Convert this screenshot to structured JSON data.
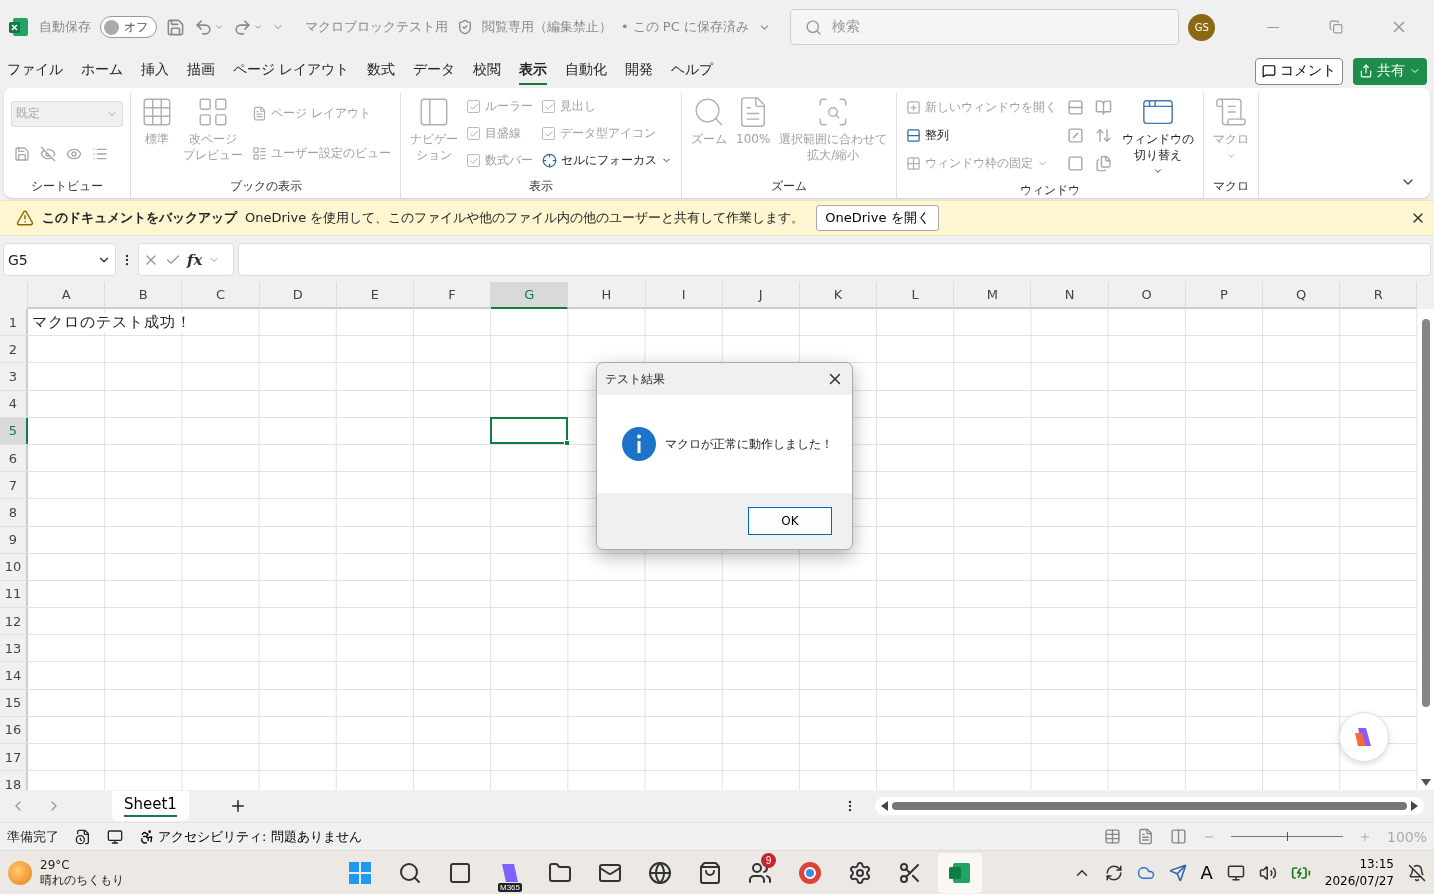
{
  "title_bar": {
    "autosave_label": "自動保存",
    "autosave": {
      "on": false,
      "label": "オフ"
    },
    "file_name": "マクロブロックテスト用",
    "mode": "閲覧専用（編集禁止）",
    "save_state": "• この PC に保存済み",
    "search_placeholder": "検索",
    "avatar": "GS"
  },
  "menu": {
    "tabs": [
      {
        "label": "ファイル",
        "selected": false
      },
      {
        "label": "ホーム",
        "selected": false
      },
      {
        "label": "挿入",
        "selected": false
      },
      {
        "label": "描画",
        "selected": false
      },
      {
        "label": "ページ レイアウト",
        "selected": false
      },
      {
        "label": "数式",
        "selected": false
      },
      {
        "label": "データ",
        "selected": false
      },
      {
        "label": "校閲",
        "selected": false
      },
      {
        "label": "表示",
        "selected": true
      },
      {
        "label": "自動化",
        "selected": false
      },
      {
        "label": "開発",
        "selected": false
      },
      {
        "label": "ヘルプ",
        "selected": false
      }
    ],
    "comment_button": "コメント",
    "share_button": "共有"
  },
  "ribbon": [
    {
      "label": "シートビュー",
      "columns": [
        [
          {
            "kind": "dropdown",
            "value": "既定",
            "disabled": true
          },
          {
            "kind": "icons",
            "disabled": true
          }
        ]
      ]
    },
    {
      "label": "ブックの表示",
      "columns": [
        [
          {
            "kind": "large",
            "label": "標準",
            "disabled": true
          }
        ],
        [
          {
            "kind": "large",
            "label": [
              "改ページ",
              "プレビュー"
            ],
            "disabled": true
          }
        ],
        [
          {
            "kind": "small",
            "label": "ページ レイアウト",
            "disabled": true
          },
          {
            "kind": "small",
            "label": "ユーザー設定のビュー",
            "disabled": true
          }
        ]
      ]
    },
    {
      "label": "表示",
      "columns": [
        [
          {
            "kind": "large",
            "label": [
              "ナビゲー",
              "ション"
            ],
            "disabled": true
          }
        ],
        [
          {
            "kind": "check",
            "label": "ルーラー",
            "checked": true,
            "disabled": true
          },
          {
            "kind": "check",
            "label": "目盛線",
            "checked": true,
            "disabled": true
          },
          {
            "kind": "check",
            "label": "数式バー",
            "checked": true,
            "disabled": true
          }
        ],
        [
          {
            "kind": "check",
            "label": "見出し",
            "checked": true,
            "disabled": true
          },
          {
            "kind": "check",
            "label": "データ型アイコン",
            "checked": true,
            "disabled": true
          },
          {
            "kind": "small",
            "label": "セルにフォーカス",
            "disabled": false,
            "menu": true
          }
        ]
      ]
    },
    {
      "label": "ズーム",
      "columns": [
        [
          {
            "kind": "large",
            "label": "ズーム",
            "disabled": true
          }
        ],
        [
          {
            "kind": "large",
            "label": "100%",
            "disabled": true
          }
        ],
        [
          {
            "kind": "large",
            "label": [
              "選択範囲に合わせて",
              "拡大/縮小"
            ],
            "disabled": true
          }
        ]
      ]
    },
    {
      "label": "ウィンドウ",
      "columns": [
        [
          {
            "kind": "small",
            "label": "新しいウィンドウを開く",
            "disabled": true
          },
          {
            "kind": "small",
            "label": "整列",
            "disabled": false
          },
          {
            "kind": "small",
            "label": "ウィンドウ枠の固定",
            "disabled": true,
            "menu": true
          }
        ],
        [
          {
            "kind": "icon",
            "disabled": true
          },
          {
            "kind": "icon",
            "disabled": true
          },
          {
            "kind": "icon",
            "disabled": true
          }
        ],
        [
          {
            "kind": "icon",
            "disabled": true
          },
          {
            "kind": "icon",
            "disabled": true
          },
          {
            "kind": "icon",
            "disabled": true
          }
        ],
        [
          {
            "kind": "large",
            "label": [
              "ウィンドウの",
              "切り替え"
            ],
            "disabled": false,
            "menu": true
          }
        ]
      ]
    },
    {
      "label": "マクロ",
      "columns": [
        [
          {
            "kind": "large",
            "label": "マクロ",
            "disabled": true,
            "menu": true
          }
        ]
      ]
    }
  ],
  "info_bar": {
    "title": "このドキュメントをバックアップ",
    "message": "OneDrive を使用して、このファイルや他のファイル内の他のユーザーと共有して作業します。",
    "button": "OneDrive を開く"
  },
  "formula_bar": {
    "name_box": "G5",
    "function_label": "fx"
  },
  "sheet": {
    "columns": [
      {
        "label": "A",
        "selected": false
      },
      {
        "label": "B",
        "selected": false
      },
      {
        "label": "C",
        "selected": false
      },
      {
        "label": "D",
        "selected": false
      },
      {
        "label": "E",
        "selected": false
      },
      {
        "label": "F",
        "selected": false
      },
      {
        "label": "G",
        "selected": true
      },
      {
        "label": "H",
        "selected": false
      },
      {
        "label": "I",
        "selected": false
      },
      {
        "label": "J",
        "selected": false
      },
      {
        "label": "K",
        "selected": false
      },
      {
        "label": "L",
        "selected": false
      },
      {
        "label": "M",
        "selected": false
      },
      {
        "label": "N",
        "selected": false
      },
      {
        "label": "O",
        "selected": false
      },
      {
        "label": "P",
        "selected": false
      },
      {
        "label": "Q",
        "selected": false
      },
      {
        "label": "R",
        "selected": false
      }
    ],
    "rows": [
      {
        "label": "1",
        "selected": false,
        "cells": [
          "マクロのテスト成功！"
        ]
      },
      {
        "label": "2",
        "selected": false
      },
      {
        "label": "3",
        "selected": false
      },
      {
        "label": "4",
        "selected": false
      },
      {
        "label": "5",
        "selected": true
      },
      {
        "label": "6",
        "selected": false
      },
      {
        "label": "7",
        "selected": false
      },
      {
        "label": "8",
        "selected": false
      },
      {
        "label": "9",
        "selected": false
      },
      {
        "label": "10",
        "selected": false
      },
      {
        "label": "11",
        "selected": false
      },
      {
        "label": "12",
        "selected": false
      },
      {
        "label": "13",
        "selected": false
      },
      {
        "label": "14",
        "selected": false
      },
      {
        "label": "15",
        "selected": false
      },
      {
        "label": "16",
        "selected": false
      },
      {
        "label": "17",
        "selected": false
      },
      {
        "label": "18",
        "selected": false
      }
    ]
  },
  "dialog": {
    "title": "テスト結果",
    "message": "マクロが正常に動作しました！",
    "button": "OK"
  },
  "sheet_tabs": [
    {
      "label": "Sheet1",
      "selected": true
    }
  ],
  "status_bar": {
    "status": "準備完了",
    "accessibility": "アクセシビリティ: 問題ありません",
    "zoom": {
      "level": 0.5,
      "reading": "100%"
    }
  },
  "taskbar": {
    "weather": {
      "temperature": "29°C",
      "condition": "晴れのちくもり"
    },
    "apps": [
      {
        "selected": false
      },
      {
        "selected": false
      },
      {
        "selected": false
      },
      {
        "selected": false,
        "label": "M365"
      },
      {
        "selected": false
      },
      {
        "selected": false
      },
      {
        "selected": false
      },
      {
        "selected": false
      },
      {
        "selected": false,
        "badge": "9"
      },
      {
        "selected": false
      },
      {
        "selected": false
      },
      {
        "selected": false
      },
      {
        "selected": true
      }
    ],
    "ime": "A",
    "time": "13:15",
    "date": "2026/07/27"
  }
}
